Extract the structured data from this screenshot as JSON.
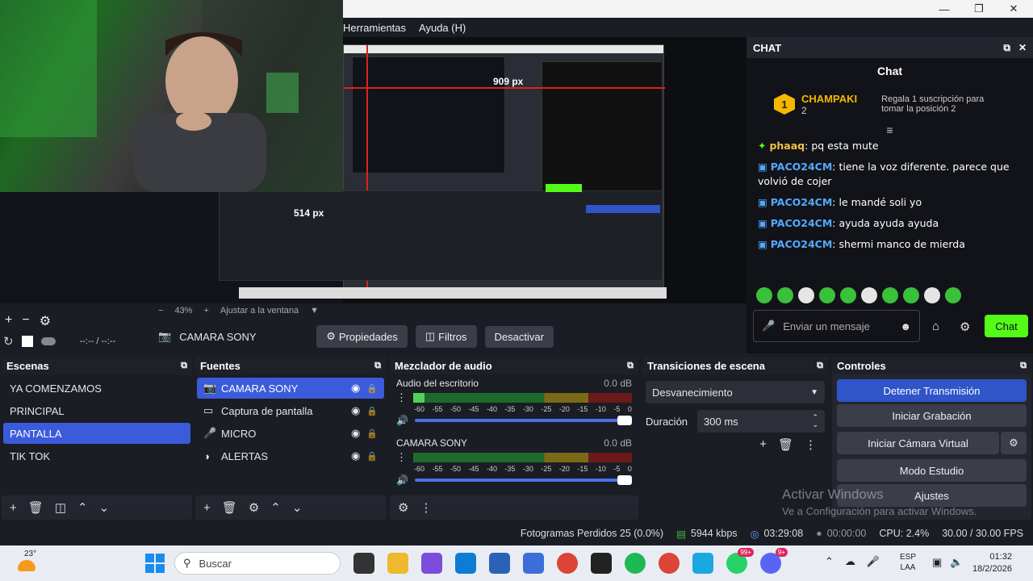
{
  "menu": {
    "items": [
      "Herramientas",
      "Ayuda (H)"
    ]
  },
  "preview": {
    "zoom": "43%",
    "fit_label": "Ajustar a la ventana",
    "overlay_width_label": "909 px",
    "overlay_height_label": "514 px",
    "time_display": "--:-- / --:--"
  },
  "chat": {
    "panel_title": "CHAT",
    "header": "Chat",
    "leader": {
      "rank": "1",
      "name": "CHAMPAKI",
      "count": "2",
      "gift_text": "Regala 1 suscripción para tomar la posición 2"
    },
    "messages": [
      {
        "user": "phaaq",
        "text": "pq esta mute",
        "color": "#f5c242"
      },
      {
        "user": "PACO24CM",
        "text": "tiene la voz diferente. parece que volvió de cojer",
        "color": "#54a9ff"
      },
      {
        "user": "PACO24CM",
        "text": "le mandé soli yo",
        "color": "#54a9ff"
      },
      {
        "user": "PACO24CM",
        "text": "ayuda ayuda ayuda",
        "color": "#54a9ff"
      },
      {
        "user": "PACO24CM",
        "text": "shermi manco de mierda",
        "color": "#54a9ff"
      }
    ],
    "input_placeholder": "Enviar un mensaje",
    "send_label": "Chat"
  },
  "source_bar": {
    "source_name": "CAMARA SONY",
    "properties_label": "Propiedades",
    "filters_label": "Filtros",
    "deactivate_label": "Desactivar"
  },
  "scenes": {
    "title": "Escenas",
    "items": [
      "YA COMENZAMOS",
      "PRINCIPAL",
      "PANTALLA",
      "TIK TOK"
    ],
    "selected": "PANTALLA"
  },
  "sources": {
    "title": "Fuentes",
    "items": [
      "CAMARA SONY",
      "Captura de pantalla",
      "MICRO",
      "ALERTAS"
    ],
    "selected": "CAMARA SONY"
  },
  "mixer": {
    "title": "Mezclador de audio",
    "scale": [
      "-60",
      "-55",
      "-50",
      "-45",
      "-40",
      "-35",
      "-30",
      "-25",
      "-20",
      "-15",
      "-10",
      "-5",
      "0"
    ],
    "channels": [
      {
        "name": "Audio del escritorio",
        "db": "0.0 dB",
        "level": 0.05,
        "volume": 1.0
      },
      {
        "name": "CAMARA SONY",
        "db": "0.0 dB",
        "level": 0.0,
        "volume": 1.0
      }
    ]
  },
  "transitions": {
    "title": "Transiciones de escena",
    "selected": "Desvanecimiento",
    "duration_label": "Duración",
    "duration_value": "300 ms"
  },
  "controls": {
    "title": "Controles",
    "buttons": [
      "Detener Transmisión",
      "Iniciar Grabación",
      "Iniciar Cámara Virtual",
      "Modo Estudio",
      "Ajustes"
    ]
  },
  "watermark": {
    "line1": "Activar Windows",
    "line2": "Ve a Configuración para activar Windows."
  },
  "status": {
    "dropped_frames": "Fotogramas Perdidos 25 (0.0%)",
    "bitrate": "5944 kbps",
    "stream_time": "03:29:08",
    "record_time": "00:00:00",
    "cpu": "CPU: 2.4%",
    "fps": "30.00 / 30.00 FPS"
  },
  "taskbar": {
    "weather": "23°",
    "search_placeholder": "Buscar",
    "lang_line1": "ESP",
    "lang_line2": "LAA",
    "time": "01:32",
    "date": "18/2/2026",
    "badge1": "99+",
    "badge2": "9+"
  },
  "colors": {
    "accent": "#3b5bdb",
    "kick_green": "#53fc18",
    "panel": "#23262f",
    "bg": "#1b1d24"
  }
}
